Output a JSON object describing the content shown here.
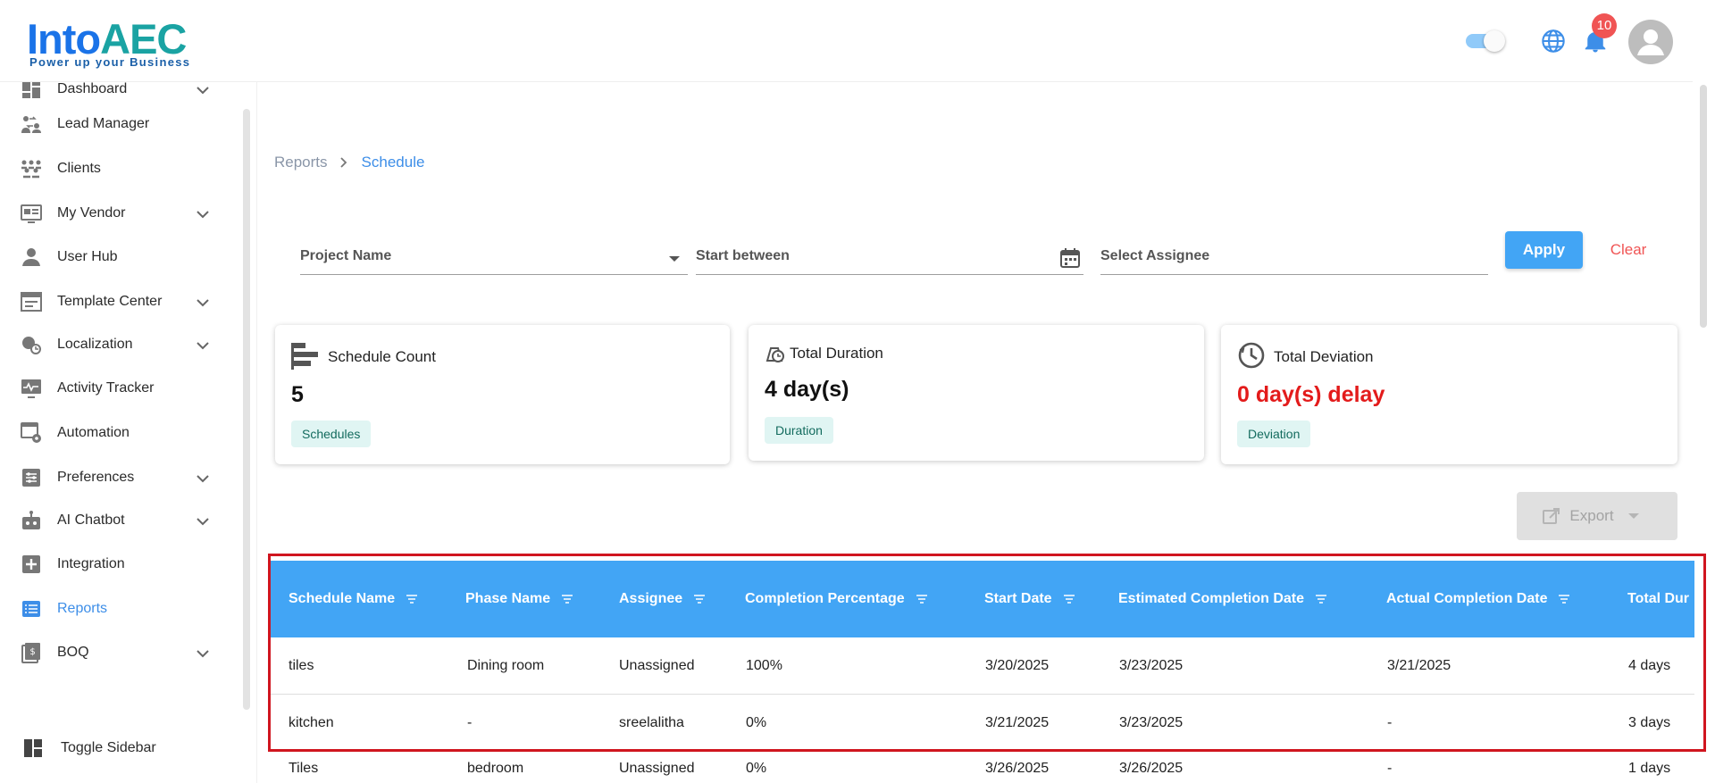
{
  "brand": {
    "name_part1": "Into",
    "name_part2": "AEC",
    "tagline": "Power up your Business"
  },
  "header": {
    "notification_count": "10"
  },
  "sidebar": {
    "items": [
      {
        "label": "Dashboard",
        "icon": "dashboard-icon",
        "expandable": true
      },
      {
        "label": "Lead Manager",
        "icon": "lead-manager-icon",
        "expandable": false
      },
      {
        "label": "Clients",
        "icon": "clients-icon",
        "expandable": false
      },
      {
        "label": "My Vendor",
        "icon": "vendor-icon",
        "expandable": true
      },
      {
        "label": "User Hub",
        "icon": "user-icon",
        "expandable": false
      },
      {
        "label": "Template Center",
        "icon": "template-icon",
        "expandable": true
      },
      {
        "label": "Localization",
        "icon": "localization-icon",
        "expandable": true
      },
      {
        "label": "Activity Tracker",
        "icon": "activity-icon",
        "expandable": false
      },
      {
        "label": "Automation",
        "icon": "automation-icon",
        "expandable": false
      },
      {
        "label": "Preferences",
        "icon": "preferences-icon",
        "expandable": true
      },
      {
        "label": "AI Chatbot",
        "icon": "chatbot-icon",
        "expandable": true
      },
      {
        "label": "Integration",
        "icon": "integration-icon",
        "expandable": false
      },
      {
        "label": "Reports",
        "icon": "reports-icon",
        "expandable": false,
        "active": true
      },
      {
        "label": "BOQ",
        "icon": "boq-icon",
        "expandable": true
      }
    ],
    "toggle_label": "Toggle Sidebar"
  },
  "breadcrumb": {
    "parent": "Reports",
    "current": "Schedule"
  },
  "filters": {
    "project_name": "Project Name",
    "start_between": "Start between",
    "select_assignee": "Select Assignee",
    "apply_label": "Apply",
    "clear_label": "Clear"
  },
  "cards": {
    "schedule": {
      "title": "Schedule Count",
      "value": "5",
      "chip": "Schedules"
    },
    "duration": {
      "title": "Total Duration",
      "value": "4 day(s)",
      "chip": "Duration"
    },
    "deviation": {
      "title": "Total Deviation",
      "value": "0 day(s) delay",
      "chip": "Deviation"
    }
  },
  "export_label": "Export",
  "table": {
    "headers": [
      "Schedule Name",
      "Phase Name",
      "Assignee",
      "Completion Percentage",
      "Start Date",
      "Estimated Completion Date",
      "Actual Completion Date",
      "Total Dur"
    ],
    "rows": [
      [
        "tiles",
        "Dining room",
        "Unassigned",
        "100%",
        "3/20/2025",
        "3/23/2025",
        "3/21/2025",
        "4 days"
      ],
      [
        "kitchen",
        "-",
        "sreelalitha",
        "0%",
        "3/21/2025",
        "3/23/2025",
        "-",
        "3 days"
      ],
      [
        "Tiles",
        "bedroom",
        "Unassigned",
        "0%",
        "3/26/2025",
        "3/26/2025",
        "-",
        "1 days"
      ]
    ]
  },
  "colors": {
    "accent": "#42a5f5",
    "danger": "#e31b1b",
    "clear": "#f05454",
    "chip_bg": "#e0f5f3",
    "outline": "#d0151f"
  }
}
